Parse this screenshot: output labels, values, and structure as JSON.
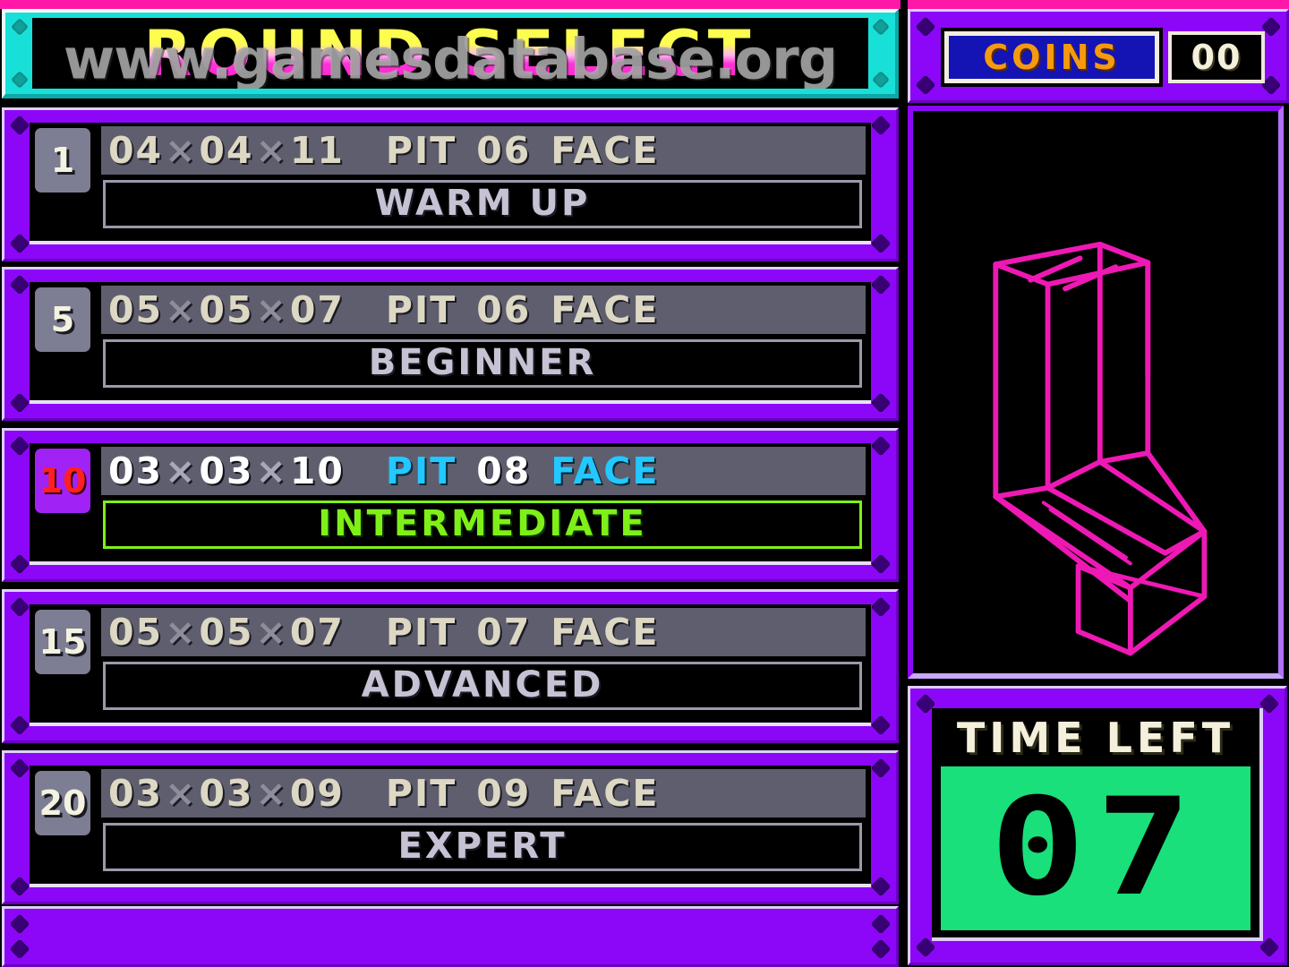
{
  "title": {
    "text": "ROUND SELECT",
    "watermark": "www.gamesdatabase.org"
  },
  "colors": {
    "panel_purple": "#8c06f7",
    "panel_highlight": "#ded0f8",
    "title_cyan": "#18e0d8",
    "accent_pink": "#ff18a8",
    "selected_green": "#7ef018",
    "selected_cyan": "#22c8ff",
    "selected_red": "#ff2020",
    "coins_orange": "#f59a10",
    "coins_blue": "#1414b4",
    "lcd_green": "#19e07a",
    "wireframe_magenta": "#ee19b4"
  },
  "rounds": [
    {
      "number": "1",
      "width": "04",
      "depth": "04",
      "height": "11",
      "pit_label": "PIT",
      "pit_value": "06",
      "face_label": "FACE",
      "name": "WARM UP",
      "selected": false
    },
    {
      "number": "5",
      "width": "05",
      "depth": "05",
      "height": "07",
      "pit_label": "PIT",
      "pit_value": "06",
      "face_label": "FACE",
      "name": "BEGINNER",
      "selected": false
    },
    {
      "number": "10",
      "width": "03",
      "depth": "03",
      "height": "10",
      "pit_label": "PIT",
      "pit_value": "08",
      "face_label": "FACE",
      "name": "INTERMEDIATE",
      "selected": true
    },
    {
      "number": "15",
      "width": "05",
      "depth": "05",
      "height": "07",
      "pit_label": "PIT",
      "pit_value": "07",
      "face_label": "FACE",
      "name": "ADVANCED",
      "selected": false
    },
    {
      "number": "20",
      "width": "03",
      "depth": "03",
      "height": "09",
      "pit_label": "PIT",
      "pit_value": "09",
      "face_label": "FACE",
      "name": "EXPERT",
      "selected": false
    }
  ],
  "separator": "×",
  "coins": {
    "label": "COINS",
    "value": "00"
  },
  "preview": {
    "shape_name": "l-block-wireframe"
  },
  "time": {
    "label": "TIME LEFT",
    "value": "07"
  }
}
